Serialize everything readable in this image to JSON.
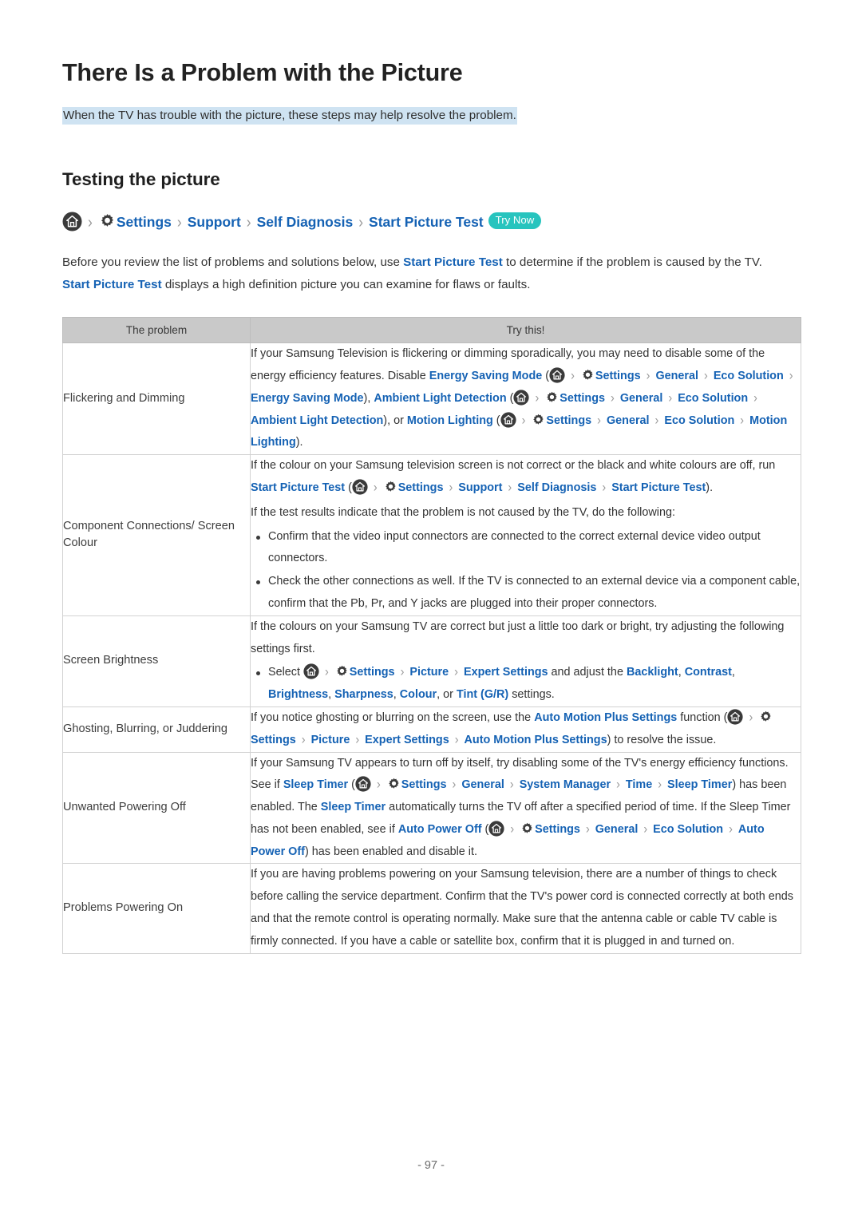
{
  "document": {
    "page_title": "There Is a Problem with the Picture",
    "lede": "When the TV has trouble with the picture, these steps may help resolve the problem.",
    "section_title": "Testing the picture",
    "page_number": "- 97 -"
  },
  "breadcrumb": {
    "home_icon": "home-icon",
    "gear_icon": "gear-icon",
    "separator": "›",
    "items": [
      "Settings",
      "Support",
      "Self Diagnosis",
      "Start Picture Test"
    ],
    "badge": "Try Now",
    "badge_color": "#27c4be",
    "link_color": "#1562b4"
  },
  "intro": {
    "p1_a": "Before you review the list of problems and solutions below, use ",
    "p1_link": "Start Picture Test",
    "p1_b": " to determine if the problem is caused by the TV. ",
    "p1_link2": "Start Picture Test",
    "p1_c": " displays a high definition picture you can examine for flaws or faults."
  },
  "table": {
    "headers": [
      "The problem",
      "Try this!"
    ],
    "rows": [
      {
        "problem": "Flickering and Dimming",
        "answer": {
          "t1": "If your Samsung Television is flickering or dimming sporadically, you may need to disable some of the energy efficiency features. Disable ",
          "l1": "Energy Saving Mode",
          "t2": " (",
          "l2": "Settings",
          "l3": "General",
          "l4": "Eco Solution",
          "l5": "Energy Saving Mode",
          "t3": "), ",
          "l6": "Ambient Light Detection",
          "t4": " (",
          "l7": "Settings",
          "l8": "General",
          "l9": "Eco Solution",
          "l10": "Ambient Light Detection",
          "t5": "), or ",
          "l11": "Motion Lighting",
          "t6": " (",
          "l12": "Settings",
          "l13": "General",
          "l14": "Eco Solution",
          "l15": "Motion Lighting",
          "t7": ")."
        }
      },
      {
        "problem": "Component Connections/ Screen Colour",
        "answer": {
          "t1": "If the colour on your Samsung television screen is not correct or the black and white colours are off, run ",
          "l1": "Start Picture Test",
          "t2": " (",
          "l2": "Settings",
          "l3": "Support",
          "l4": "Self Diagnosis",
          "l5": "Start Picture Test",
          "t3": ").",
          "t4": "If the test results indicate that the problem is not caused by the TV, do the following:",
          "b1": "Confirm that the video input connectors are connected to the correct external device video output connectors.",
          "b2": "Check the other connections as well. If the TV is connected to an external device via a component cable, confirm that the Pb, Pr, and Y jacks are plugged into their proper connectors."
        }
      },
      {
        "problem": "Screen Brightness",
        "answer": {
          "t1": "If the colours on your Samsung TV are correct but just a little too dark or bright, try adjusting the following settings first.",
          "b1_a": "Select ",
          "l1": "Settings",
          "l2": "Picture",
          "l3": "Expert Settings",
          "b1_b": " and adjust the ",
          "l4": "Backlight",
          "b1_c": ", ",
          "l5": "Contrast",
          "b1_d": ", ",
          "l6": "Brightness",
          "b1_e": ", ",
          "l7": "Sharpness",
          "b1_f": ", ",
          "l8": "Colour",
          "b1_g": ", or ",
          "l9": "Tint (G/R)",
          "b1_h": " settings."
        }
      },
      {
        "problem": "Ghosting, Blurring, or Juddering",
        "answer": {
          "t1": "If you notice ghosting or blurring on the screen, use the ",
          "l1": "Auto Motion Plus Settings",
          "t2": " function (",
          "l2": "Settings",
          "l3": "Picture",
          "l4": "Expert Settings",
          "l5": "Auto Motion Plus Settings",
          "t3": ") to resolve the issue."
        }
      },
      {
        "problem": "Unwanted Powering Off",
        "answer": {
          "t1": "If your Samsung TV appears to turn off by itself, try disabling some of the TV's energy efficiency functions. See if ",
          "l1": "Sleep Timer",
          "t2": " (",
          "l2": "Settings",
          "l3": "General",
          "l4": "System Manager",
          "l5": "Time",
          "l6": "Sleep Timer",
          "t3": ") has been enabled. The ",
          "l7": "Sleep Timer",
          "t4": " automatically turns the TV off after a specified period of time. If the Sleep Timer has not been enabled, see if ",
          "l8": "Auto Power Off",
          "t5": " (",
          "l9": "Settings",
          "l10": "General",
          "l11": "Eco Solution",
          "l12": "Auto Power Off",
          "t6": ") has been enabled and disable it."
        }
      },
      {
        "problem": "Problems Powering On",
        "answer": {
          "t1": "If you are having problems powering on your Samsung television, there are a number of things to check before calling the service department. Confirm that the TV's power cord is connected correctly at both ends and that the remote control is operating normally. Make sure that the antenna cable or cable TV cable is firmly connected. If you have a cable or satellite box, confirm that it is plugged in and turned on."
        }
      }
    ]
  }
}
